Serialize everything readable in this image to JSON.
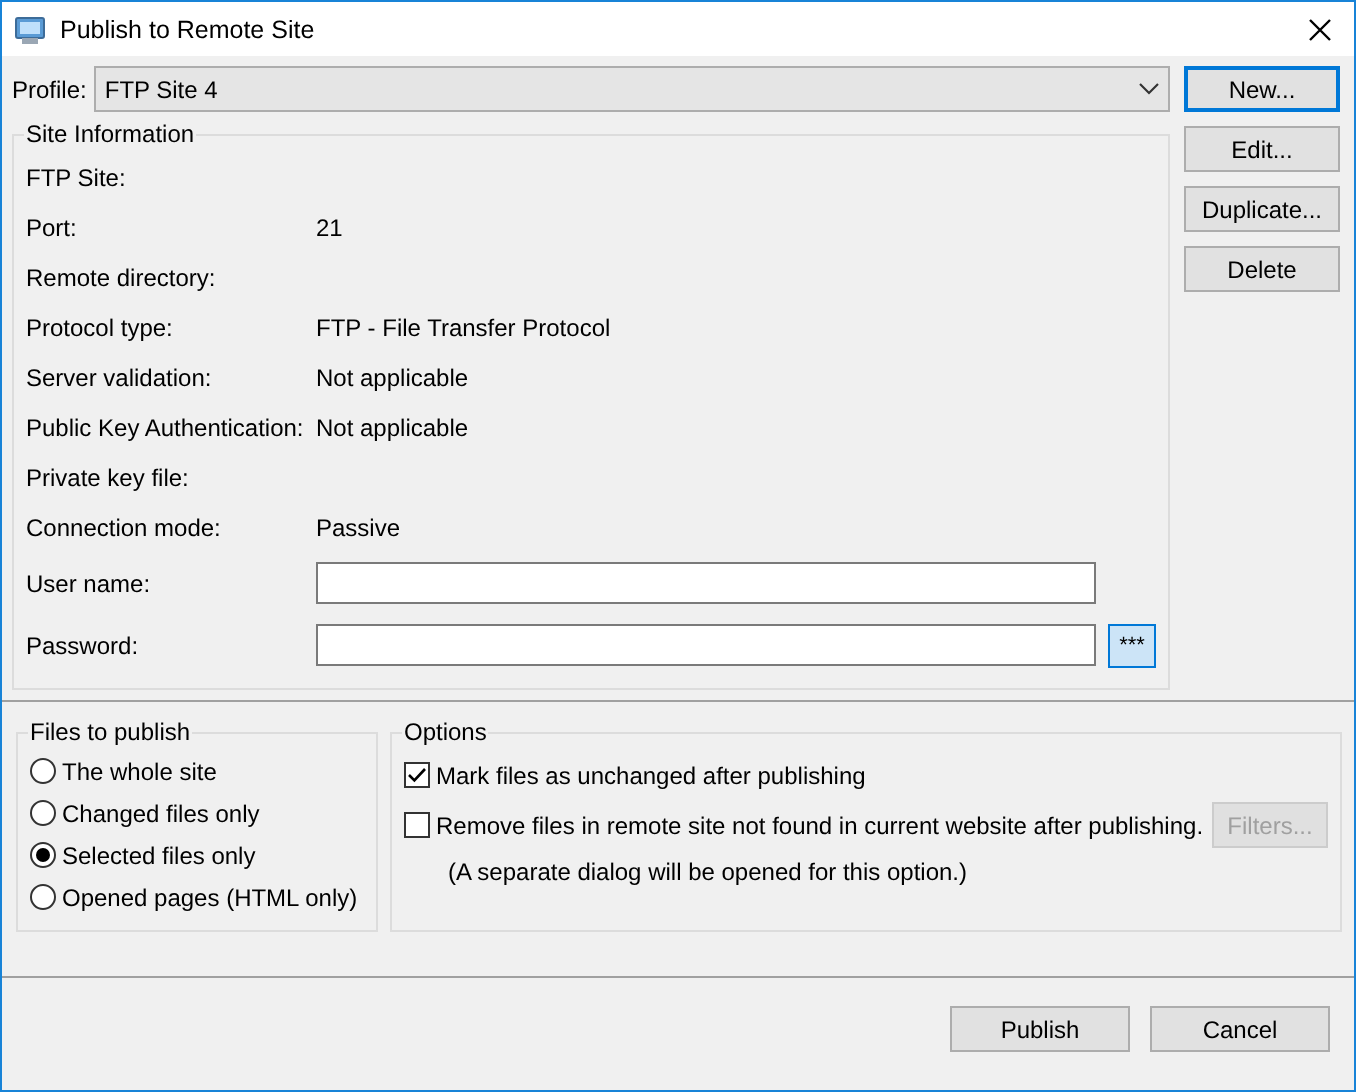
{
  "window": {
    "title": "Publish to Remote Site"
  },
  "profile": {
    "label": "Profile:",
    "value": "FTP Site 4"
  },
  "side_buttons": [
    {
      "label": "New...",
      "focused": true
    },
    {
      "label": "Edit...",
      "focused": false
    },
    {
      "label": "Duplicate...",
      "focused": false
    },
    {
      "label": "Delete",
      "focused": false
    }
  ],
  "site_information": {
    "title": "Site Information",
    "fields": [
      {
        "kind": "text",
        "label": "FTP Site:"
      },
      {
        "kind": "text",
        "label": "Port:",
        "value": "21"
      },
      {
        "kind": "text",
        "label": "Remote directory:"
      },
      {
        "kind": "text",
        "label": "Protocol type:",
        "value": "FTP - File Transfer Protocol"
      },
      {
        "kind": "text",
        "label": "Server validation:",
        "value": "Not applicable"
      },
      {
        "kind": "text",
        "label": "Public Key Authentication:",
        "value": "Not applicable"
      },
      {
        "kind": "text",
        "label": "Private key file:"
      },
      {
        "kind": "text",
        "label": "Connection mode:",
        "value": "Passive"
      },
      {
        "kind": "input",
        "label": "User name:"
      },
      {
        "kind": "password",
        "label": "Password:",
        "button": "***"
      }
    ]
  },
  "files_to_publish": {
    "title": "Files to publish",
    "options": [
      {
        "label": "The whole site",
        "selected": false
      },
      {
        "label": "Changed files only",
        "selected": false
      },
      {
        "label": "Selected files only",
        "selected": true
      },
      {
        "label": "Opened pages (HTML only)",
        "selected": false
      }
    ]
  },
  "options": {
    "title": "Options",
    "items": [
      {
        "label": "Mark files as unchanged after publishing",
        "checked": true
      },
      {
        "label": "Remove files in remote site not found in current website after publishing.",
        "checked": false,
        "button": {
          "label": "Filters...",
          "disabled": true
        }
      }
    ],
    "note": "(A separate dialog will be opened for this option.)"
  },
  "footer_buttons": [
    {
      "label": "Publish"
    },
    {
      "label": "Cancel"
    }
  ]
}
